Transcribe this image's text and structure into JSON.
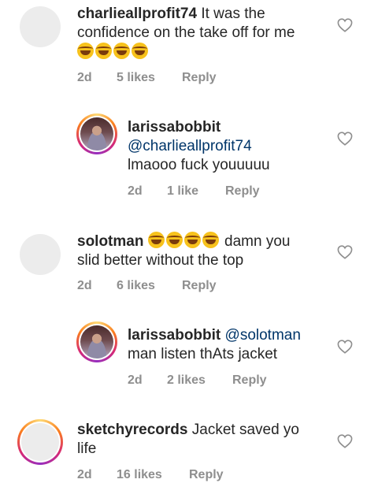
{
  "comments": [
    {
      "username": "charlieallprofit74",
      "text_line1": "It was the",
      "text_line2": "confidence on the take off for me",
      "emoji_count": 4,
      "time": "2d",
      "likes": "5 likes",
      "reply": "Reply",
      "avatar": "placeholder-avatar"
    },
    {
      "username": "larissabobbit",
      "mention": "@charlieallprofit74",
      "text": "lmaooo fuck youuuuu",
      "time": "2d",
      "likes": "1 like",
      "reply": "Reply",
      "avatar": "story-ring-photo-avatar"
    },
    {
      "username": "solotman",
      "emoji_count": 4,
      "text_line1": "damn you",
      "text_line2": "slid better without the top",
      "time": "2d",
      "likes": "6 likes",
      "reply": "Reply",
      "avatar": "placeholder-avatar"
    },
    {
      "username": "larissabobbit",
      "mention": "@solotman",
      "text": "man listen thAts jacket",
      "time": "2d",
      "likes": "2 likes",
      "reply": "Reply",
      "avatar": "story-ring-photo-avatar"
    },
    {
      "username": "sketchyrecords",
      "text_line1": "Jacket saved yo",
      "text_line2": "life",
      "time": "2d",
      "likes": "16 likes",
      "reply": "Reply",
      "avatar": "story-ring-placeholder-avatar"
    }
  ],
  "icons": {
    "like": "heart-outline-icon",
    "emoji": "face-with-tears-of-joy-emoji"
  },
  "colors": {
    "text": "#262626",
    "meta": "#8e8e8e",
    "mention": "#003569",
    "heart": "#8e8e8e"
  }
}
